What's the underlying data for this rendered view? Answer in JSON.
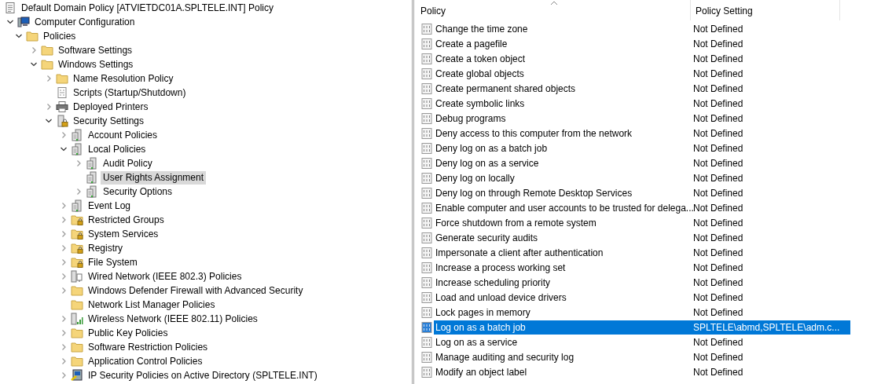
{
  "console_root": {
    "label": "Default Domain Policy [ATVIETDC01A.SPLTELE.INT] Policy",
    "kind": "doc"
  },
  "tree": [
    {
      "label": "Computer Configuration",
      "kind": "computer",
      "expanded": true,
      "selected": false,
      "children": [
        {
          "label": "Policies",
          "kind": "folder",
          "expanded": true,
          "selected": false,
          "children": [
            {
              "label": "Software Settings",
              "kind": "folder",
              "expanded": false,
              "selected": false
            },
            {
              "label": "Windows Settings",
              "kind": "folder",
              "expanded": true,
              "selected": false,
              "children": [
                {
                  "label": "Name Resolution Policy",
                  "kind": "folder",
                  "expanded": false,
                  "selected": false
                },
                {
                  "label": "Scripts (Startup/Shutdown)",
                  "kind": "script",
                  "selected": false
                },
                {
                  "label": "Deployed Printers",
                  "kind": "printer",
                  "expanded": false,
                  "selected": false
                },
                {
                  "label": "Security Settings",
                  "kind": "secure",
                  "expanded": true,
                  "selected": false,
                  "children": [
                    {
                      "label": "Account Policies",
                      "kind": "server",
                      "expanded": false,
                      "selected": false
                    },
                    {
                      "label": "Local Policies",
                      "kind": "server",
                      "expanded": true,
                      "selected": false,
                      "children": [
                        {
                          "label": "Audit Policy",
                          "kind": "server",
                          "expanded": false,
                          "selected": false
                        },
                        {
                          "label": "User Rights Assignment",
                          "kind": "server",
                          "selected": true
                        },
                        {
                          "label": "Security Options",
                          "kind": "server",
                          "expanded": false,
                          "selected": false
                        }
                      ]
                    },
                    {
                      "label": "Event Log",
                      "kind": "server",
                      "expanded": false,
                      "selected": false
                    },
                    {
                      "label": "Restricted Groups",
                      "kind": "folder-lock",
                      "expanded": false,
                      "selected": false
                    },
                    {
                      "label": "System Services",
                      "kind": "folder-lock",
                      "expanded": false,
                      "selected": false
                    },
                    {
                      "label": "Registry",
                      "kind": "folder-lock",
                      "expanded": false,
                      "selected": false
                    },
                    {
                      "label": "File System",
                      "kind": "folder-lock",
                      "expanded": false,
                      "selected": false
                    },
                    {
                      "label": "Wired Network (IEEE 802.3) Policies",
                      "kind": "wired",
                      "expanded": false,
                      "selected": false
                    },
                    {
                      "label": "Windows Defender Firewall with Advanced Security",
                      "kind": "folder",
                      "expanded": false,
                      "selected": false
                    },
                    {
                      "label": "Network List Manager Policies",
                      "kind": "folder",
                      "selected": false
                    },
                    {
                      "label": "Wireless Network (IEEE 802.11) Policies",
                      "kind": "wireless",
                      "expanded": false,
                      "selected": false
                    },
                    {
                      "label": "Public Key Policies",
                      "kind": "folder",
                      "expanded": false,
                      "selected": false
                    },
                    {
                      "label": "Software Restriction Policies",
                      "kind": "folder",
                      "expanded": false,
                      "selected": false
                    },
                    {
                      "label": "Application Control Policies",
                      "kind": "folder",
                      "expanded": false,
                      "selected": false
                    },
                    {
                      "label": "IP Security Policies on Active Directory (SPLTELE.INT)",
                      "kind": "ipsec",
                      "expanded": false,
                      "selected": false
                    }
                  ]
                }
              ]
            }
          ]
        }
      ]
    }
  ],
  "table": {
    "columns": [
      "Policy",
      "Policy Setting"
    ],
    "rows": [
      {
        "policy": "Change the time zone",
        "setting": "Not Defined",
        "selected": false
      },
      {
        "policy": "Create a pagefile",
        "setting": "Not Defined",
        "selected": false
      },
      {
        "policy": "Create a token object",
        "setting": "Not Defined",
        "selected": false
      },
      {
        "policy": "Create global objects",
        "setting": "Not Defined",
        "selected": false
      },
      {
        "policy": "Create permanent shared objects",
        "setting": "Not Defined",
        "selected": false
      },
      {
        "policy": "Create symbolic links",
        "setting": "Not Defined",
        "selected": false
      },
      {
        "policy": "Debug programs",
        "setting": "Not Defined",
        "selected": false
      },
      {
        "policy": "Deny access to this computer from the network",
        "setting": "Not Defined",
        "selected": false
      },
      {
        "policy": "Deny log on as a batch job",
        "setting": "Not Defined",
        "selected": false
      },
      {
        "policy": "Deny log on as a service",
        "setting": "Not Defined",
        "selected": false
      },
      {
        "policy": "Deny log on locally",
        "setting": "Not Defined",
        "selected": false
      },
      {
        "policy": "Deny log on through Remote Desktop Services",
        "setting": "Not Defined",
        "selected": false
      },
      {
        "policy": "Enable computer and user accounts to be trusted for delega...",
        "setting": "Not Defined",
        "selected": false
      },
      {
        "policy": "Force shutdown from a remote system",
        "setting": "Not Defined",
        "selected": false
      },
      {
        "policy": "Generate security audits",
        "setting": "Not Defined",
        "selected": false
      },
      {
        "policy": "Impersonate a client after authentication",
        "setting": "Not Defined",
        "selected": false
      },
      {
        "policy": "Increase a process working set",
        "setting": "Not Defined",
        "selected": false
      },
      {
        "policy": "Increase scheduling priority",
        "setting": "Not Defined",
        "selected": false
      },
      {
        "policy": "Load and unload device drivers",
        "setting": "Not Defined",
        "selected": false
      },
      {
        "policy": "Lock pages in memory",
        "setting": "Not Defined",
        "selected": false
      },
      {
        "policy": "Log on as a batch job",
        "setting": "SPLTELE\\abmd,SPLTELE\\adm.c...",
        "selected": true
      },
      {
        "policy": "Log on as a service",
        "setting": "Not Defined",
        "selected": false
      },
      {
        "policy": "Manage auditing and security log",
        "setting": "Not Defined",
        "selected": false
      },
      {
        "policy": "Modify an object label",
        "setting": "Not Defined",
        "selected": false
      }
    ]
  }
}
